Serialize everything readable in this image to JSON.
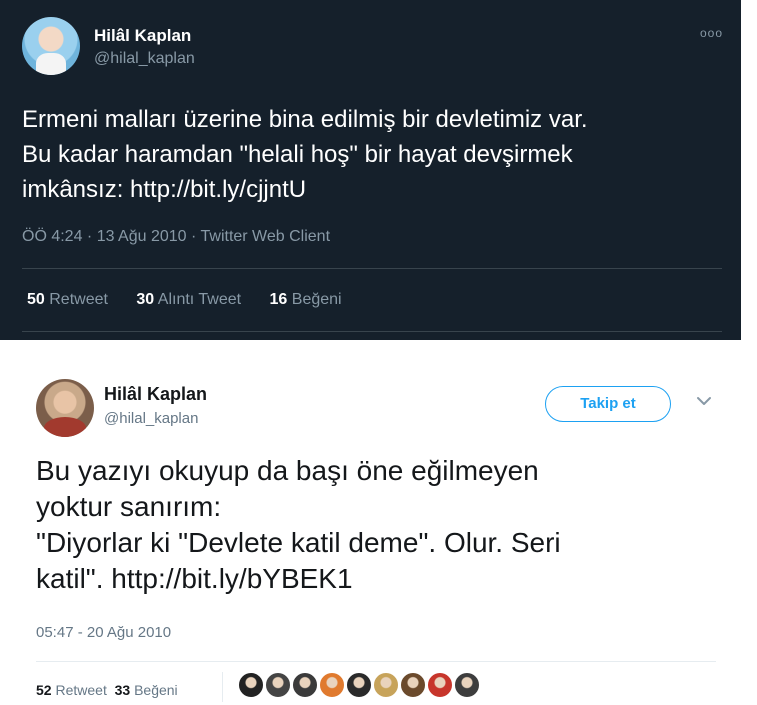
{
  "tweet_dark": {
    "name": "Hilâl Kaplan",
    "handle": "@hilal_kaplan",
    "more_icon": "ooo",
    "text_lines": [
      "Ermeni malları üzerine bina edilmiş bir devletimiz var.",
      "Bu kadar haramdan \"helali hoş\" bir hayat devşirmek",
      "imkânsız: "
    ],
    "link": "http://bit.ly/cjjntU",
    "meta": "ÖÖ 4:24 · 13 Ağu 2010 · Twitter Web Client",
    "retweets_count": "50",
    "retweets_label": "Retweet",
    "quotes_count": "30",
    "quotes_label": "Alıntı Tweet",
    "likes_count": "16",
    "likes_label": "Beğeni"
  },
  "tweet_light": {
    "name": "Hilâl Kaplan",
    "handle": "@hilal_kaplan",
    "follow_label": "Takip et",
    "text_lines": [
      "Bu yazıyı okuyup da başı öne eğilmeyen",
      "yoktur sanırım:",
      "\"Diyorlar ki \"Devlete katil deme\". Olur. Seri",
      "katil\". "
    ],
    "link": "http://bit.ly/bYBEK1",
    "meta": "05:47 - 20 Ağu 2010",
    "retweets_count": "52",
    "retweets_label": "Retweet",
    "likes_count": "33",
    "likes_label": "Beğeni",
    "liker_colors": [
      "#222222",
      "#444444",
      "#3a3a3a",
      "#e07a2e",
      "#2a2a2a",
      "#c7a35a",
      "#6b4a2c",
      "#c7352b",
      "#3d3d3d"
    ]
  },
  "colors": {
    "dark_bg": "#15202b",
    "twitter_blue": "#1da1f2",
    "muted_dark": "#8899a6",
    "muted_light": "#657786"
  }
}
